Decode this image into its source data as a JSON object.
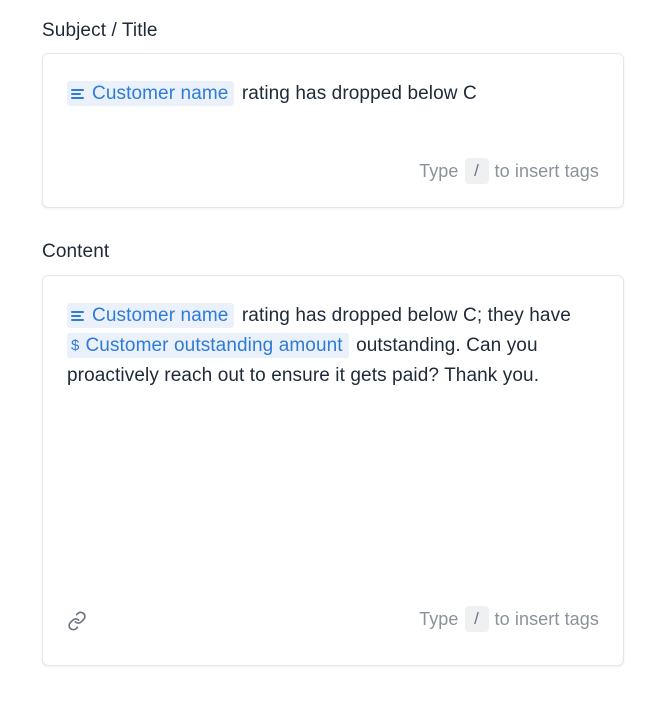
{
  "subject": {
    "label": "Subject / Title",
    "tag_customer_name": "Customer name",
    "text_after": " rating has dropped below C",
    "hint_prefix": "Type",
    "hint_key": "/",
    "hint_suffix": "to insert tags"
  },
  "content": {
    "label": "Content",
    "tag_customer_name": "Customer name",
    "text_1": " rating has dropped below C; they have ",
    "tag_outstanding_icon": "$",
    "tag_outstanding": "Customer outstanding amount",
    "text_2": " outstanding. Can you proactively reach out to ensure it gets paid? Thank you.",
    "hint_prefix": "Type",
    "hint_key": "/",
    "hint_suffix": "to insert tags"
  },
  "colors": {
    "tag_bg": "#eaf1fb",
    "tag_text": "#2f7bd8",
    "hint_text": "#8b929b",
    "border": "#e3e6ea"
  },
  "icons": {
    "text_tag": "text-lines-icon",
    "currency_tag": "dollar-icon",
    "attachment": "link-icon"
  }
}
